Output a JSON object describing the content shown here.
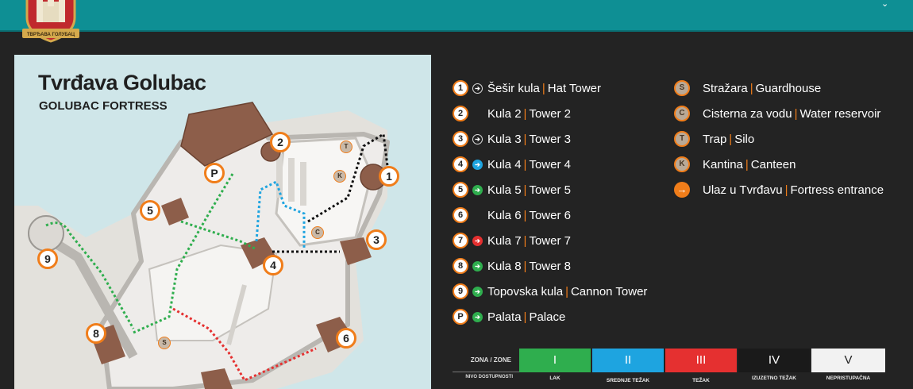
{
  "colors": {
    "header": "#0e8f94",
    "accent": "#f07d1a",
    "water": "#cfe6e9",
    "zone_i": "#2fae4e",
    "zone_ii": "#1ea4e0",
    "zone_iii": "#e53030",
    "zone_iv": "#1a1a1a",
    "zone_v": "#f2f2f2"
  },
  "logo": {
    "icon": "golubac-fortress-crest",
    "text": "ТВРЂАВА ГОЛУБАЦ"
  },
  "map": {
    "title": "Tvrđava Golubac",
    "subtitle": "GOLUBAC FORTRESS",
    "markers": [
      "1",
      "2",
      "3",
      "4",
      "5",
      "6",
      "8",
      "9",
      "P"
    ],
    "small_markers": [
      "T",
      "K",
      "C",
      "S"
    ]
  },
  "legend_left": [
    {
      "badge": "1",
      "route": "black",
      "local": "Šešir kula",
      "english": "Hat Tower"
    },
    {
      "badge": "2",
      "route": "none",
      "local": "Kula 2",
      "english": "Tower 2"
    },
    {
      "badge": "3",
      "route": "black",
      "local": "Kula 3",
      "english": "Tower 3"
    },
    {
      "badge": "4",
      "route": "blue",
      "local": "Kula 4",
      "english": "Tower 4"
    },
    {
      "badge": "5",
      "route": "green",
      "local": "Kula 5",
      "english": "Tower 5"
    },
    {
      "badge": "6",
      "route": "none",
      "local": "Kula 6",
      "english": "Tower 6"
    },
    {
      "badge": "7",
      "route": "red",
      "local": "Kula 7",
      "english": "Tower 7"
    },
    {
      "badge": "8",
      "route": "green",
      "local": "Kula 8",
      "english": "Tower 8"
    },
    {
      "badge": "9",
      "route": "green",
      "local": "Topovska kula",
      "english": "Cannon Tower"
    },
    {
      "badge": "P",
      "route": "green",
      "local": "Palata",
      "english": "Palace"
    }
  ],
  "legend_right": [
    {
      "badge": "S",
      "local": "Stražara",
      "english": "Guardhouse"
    },
    {
      "badge": "C",
      "local": "Cisterna za vodu",
      "english": "Water reservoir"
    },
    {
      "badge": "T",
      "local": "Trap",
      "english": "Silo"
    },
    {
      "badge": "K",
      "local": "Kantina",
      "english": "Canteen"
    },
    {
      "badge": "→",
      "local": "Ulaz u Tvrđavu",
      "english": "Fortress entrance"
    }
  ],
  "route_arrow": "➔",
  "separator": "|",
  "zones": {
    "label": "ZONA / ZONE",
    "level_label": "NIVO DOSTUPNOSTI",
    "items": [
      {
        "id": "I",
        "level": "LAK"
      },
      {
        "id": "II",
        "level": "SREDNJE TEŽAK"
      },
      {
        "id": "III",
        "level": "TEŽAK"
      },
      {
        "id": "IV",
        "level": "IZUZETNO TEŽAK"
      },
      {
        "id": "V",
        "level": "NEPRISTUPAČNA"
      }
    ]
  }
}
